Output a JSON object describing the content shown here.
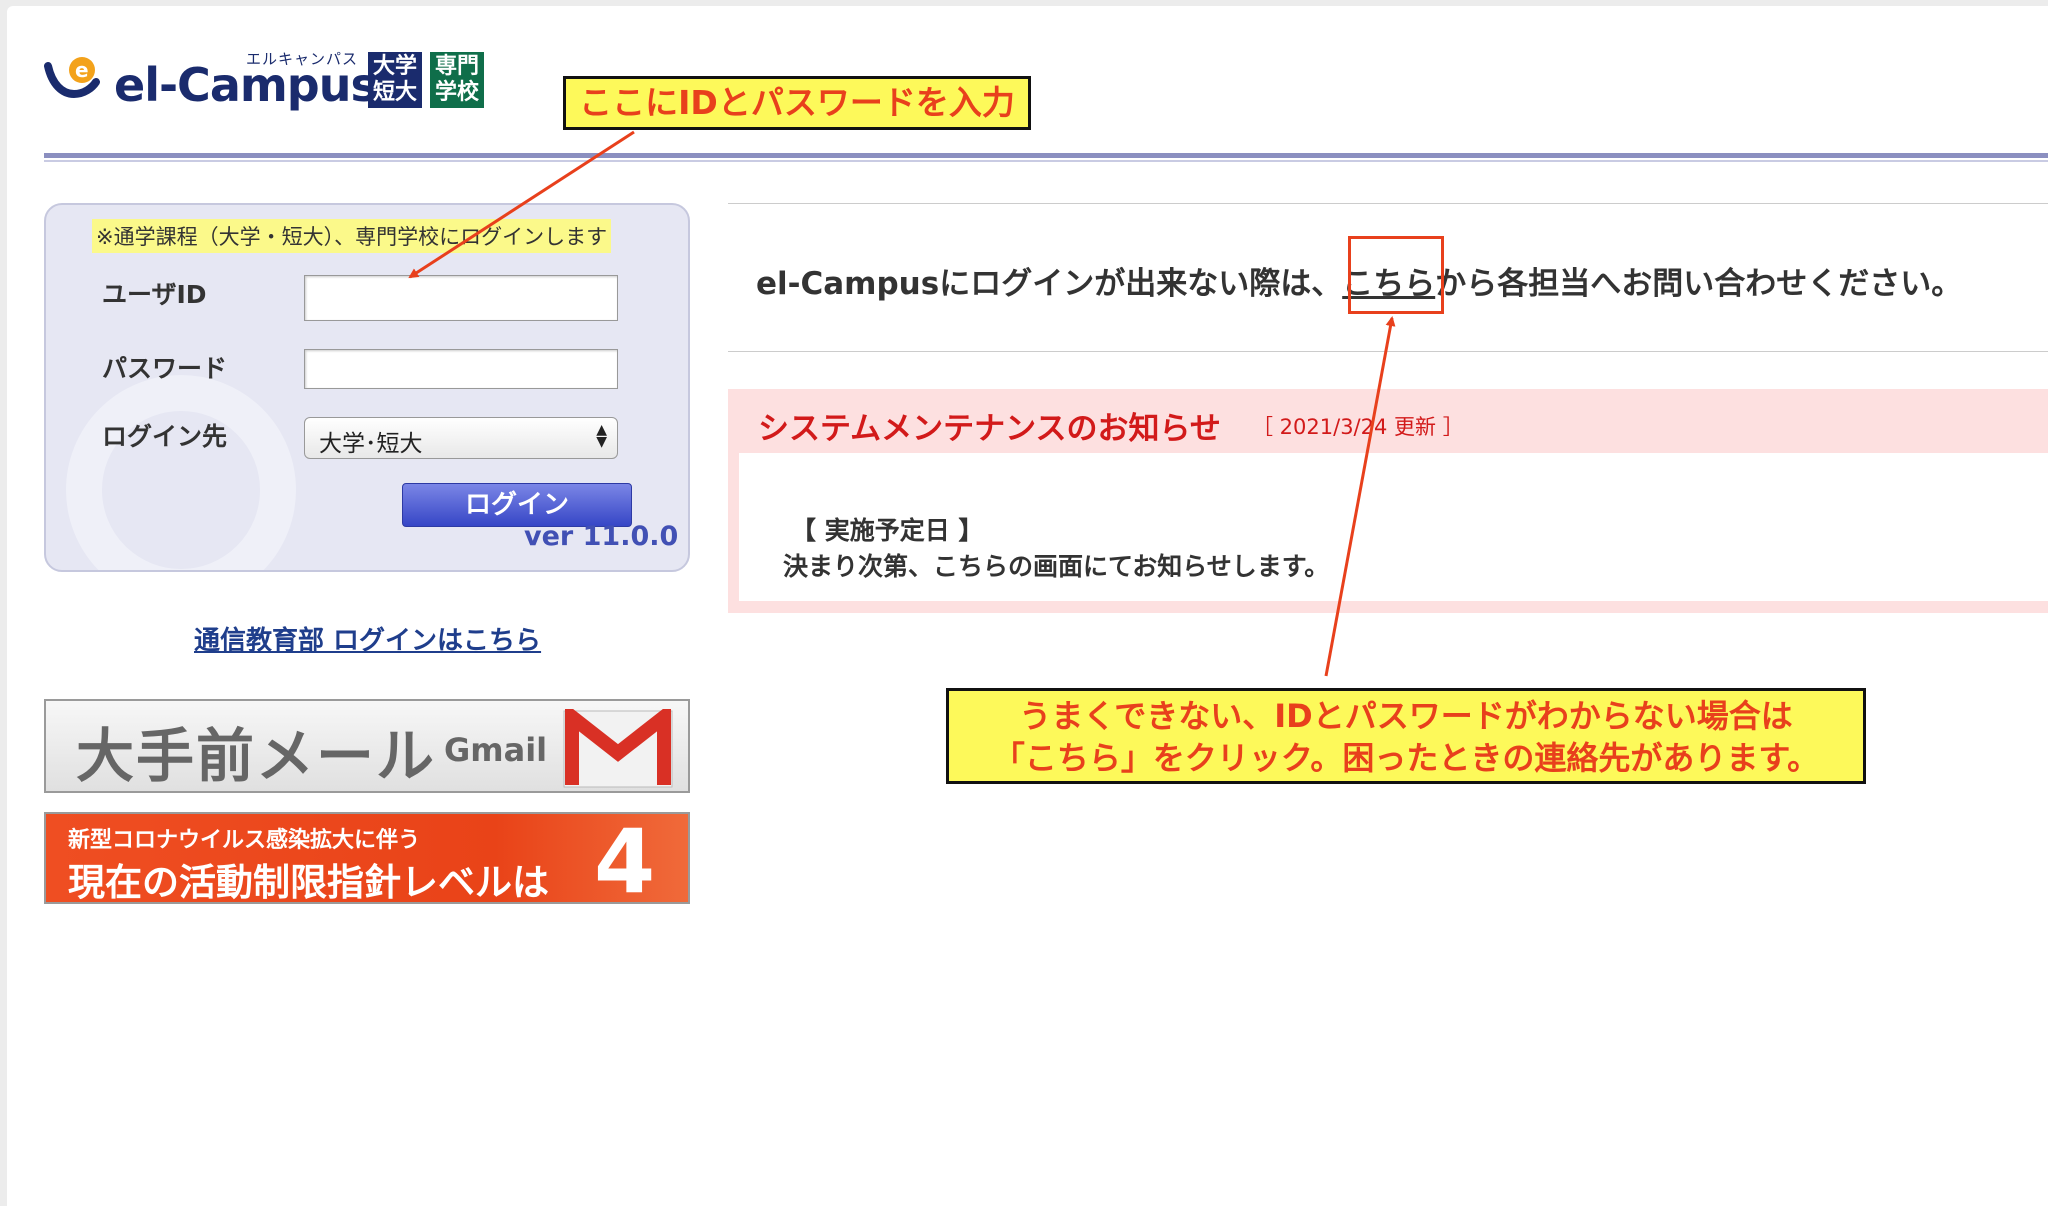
{
  "logo": {
    "kana": "エルキャンパス",
    "text": "el-Campus",
    "badge_left": "大学 短大",
    "badge_right": "専門 学校"
  },
  "login": {
    "note": "※通学課程（大学・短大）、専門学校にログインします",
    "userid_label": "ユーザID",
    "password_label": "パスワード",
    "login_target_label": "ログイン先",
    "login_target_value": "大学･短大",
    "login_button": "ログイン",
    "version": "ver 11.0.0"
  },
  "tsushin_link": "通信教育部 ログインはこちら",
  "banners": {
    "mail_title": "大手前メール",
    "mail_gmail": "Gmail",
    "covid_sub": "新型コロナウイルス感染拡大に伴う",
    "covid_main": "現在の活動制限指針レベルは",
    "covid_level": "4"
  },
  "contact": {
    "prefix": "el-Campusにログインが出来ない際は、",
    "link": "こちら",
    "suffix": "から各担当へお問い合わせください。"
  },
  "maintenance": {
    "title": "システムメンテナンスのお知らせ",
    "date": "［ 2021/3/24 更新 ］",
    "head": "【 実施予定日 】",
    "body": "決まり次第、こちらの画面にてお知らせします。"
  },
  "annotations": {
    "callout_1": "ここにIDとパスワードを入力",
    "callout_2_line1": "うまくできない、IDとパスワードがわからない場合は",
    "callout_2_line2": "「こちら」をクリック。困ったときの連絡先があります。"
  },
  "colors": {
    "brand_navy": "#1a2b6d",
    "brand_green": "#0f6e4a",
    "login_button": "#3646c6",
    "alert_red": "#d21a1a",
    "annotation_red": "#e8401c",
    "annotation_yellow": "#fdf95a"
  }
}
